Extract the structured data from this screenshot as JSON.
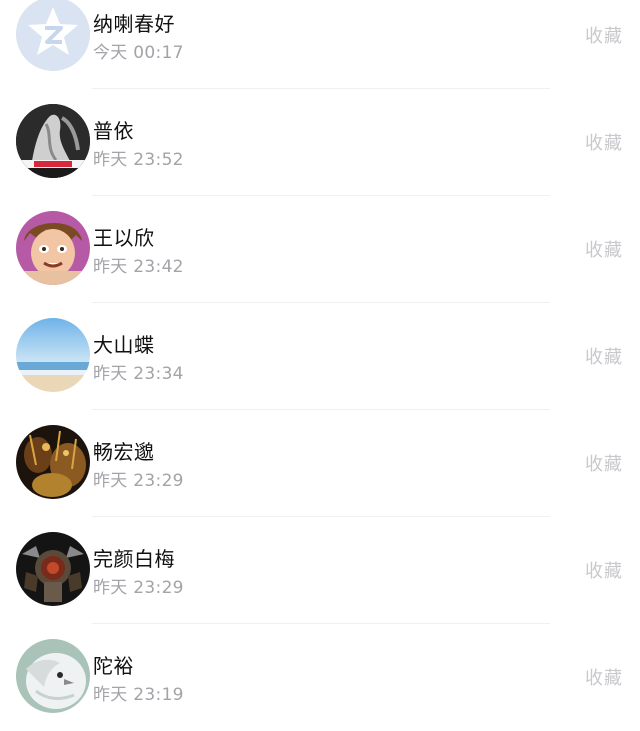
{
  "fav_label": "收藏",
  "rows": [
    {
      "name": "纳喇春好",
      "time": "今天 00:17",
      "avatar_icon": "qzone-star-icon"
    },
    {
      "name": "普依",
      "time": "昨天 23:52",
      "avatar_icon": "bw-photo-avatar"
    },
    {
      "name": "王以欣",
      "time": "昨天 23:42",
      "avatar_icon": "cartoon-face-avatar"
    },
    {
      "name": "大山蝶",
      "time": "昨天 23:34",
      "avatar_icon": "beach-sky-avatar"
    },
    {
      "name": "畅宏邈",
      "time": "昨天 23:29",
      "avatar_icon": "dark-amber-photo-avatar"
    },
    {
      "name": "完颜白梅",
      "time": "昨天 23:29",
      "avatar_icon": "armored-figure-avatar"
    },
    {
      "name": "陀裕",
      "time": "昨天 23:19",
      "avatar_icon": "white-bird-avatar"
    }
  ],
  "colors": {
    "name": "#111111",
    "time": "#a3a3a8",
    "fav": "#c9c9cd",
    "divider": "#f0f0f2"
  }
}
